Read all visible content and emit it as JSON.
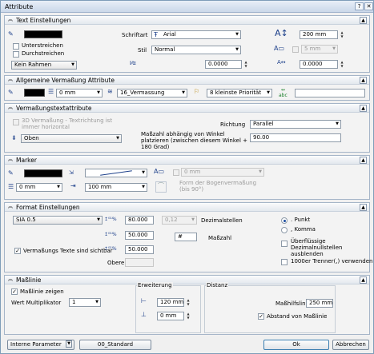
{
  "window": {
    "title": "Attribute"
  },
  "text_settings": {
    "title": "Text Einstellungen",
    "underline_label": "Unterstreichen",
    "strike_label": "Durchstreichen",
    "frame_value": "Kein Rahmen",
    "font_label": "Schriftart",
    "font_value": "Arial",
    "style_label": "Stil",
    "style_value": "Normal",
    "slant_value": "0.0000",
    "height_value": "200 mm",
    "frame_offset_value": "5 mm",
    "width_factor_value": "0.0000"
  },
  "dimension_attributes": {
    "title": "Allgemeine Vermaßung Attribute",
    "line_weight_value": "0 mm",
    "layer_value": "16_Vermassung",
    "priority_value": "8 kleinste Priorität",
    "text_value": ""
  },
  "dim_text_attributes": {
    "title": "Vermaßungstextattribute",
    "three_d_label": "3D Vermaßung - Textrichtung ist immer horizontal",
    "position_value": "Oben",
    "direction_label": "Richtung",
    "direction_value": "Parallel",
    "angle_label": "Maßzahl abhängig von Winkel platzieren (zwischen diesem Winkel + 180 Grad)",
    "angle_value": "90.00"
  },
  "marker": {
    "title": "Marker",
    "weight_value": "0 mm",
    "size_value": "100 mm",
    "text_offset_value": "0 mm",
    "arc_form_label": "Form der Bogenvermaßung (bis 90°)"
  },
  "format_settings": {
    "title": "Format Einstellungen",
    "unit_value": "SIA 0.5",
    "precision_1_value": "80.000",
    "precision_2_value": "50.000",
    "precision_3_value": "50.000",
    "decimals_label": "Dezimalstellen",
    "decimals_value": "0,12",
    "dimension_label": "Maßzahl",
    "dimension_value": "#",
    "visible_label": "Vermaßungs Texte sind sichtbar",
    "above_label": "Obere",
    "above_value": "",
    "point_label": ". Punkt",
    "comma_label": ", Komma",
    "hide_zeros_label": "Überflüssige Dezimalnullstellen ausblenden",
    "thousand_label": "1000er Trenner(,) verwenden"
  },
  "extension_lines": {
    "title": "Maßlinie",
    "show_label": "Maßlinie zeigen",
    "multiplier_label": "Wert Multiplikator",
    "multiplier_value": "1",
    "extension_label": "Erweiterung",
    "ext_value_1": "120 mm",
    "ext_value_2": "0 mm",
    "distance_label": "Distanz",
    "dist_line_label": "Maßhilfslinie",
    "dist_line_value": "250 mm",
    "distance_from_label": "Abstand von Maßlinie"
  },
  "footer": {
    "internal_label": "Interne Parameter",
    "standard_value": "00_Standard",
    "ok_label": "Ok",
    "cancel_label": "Abbrechen"
  }
}
